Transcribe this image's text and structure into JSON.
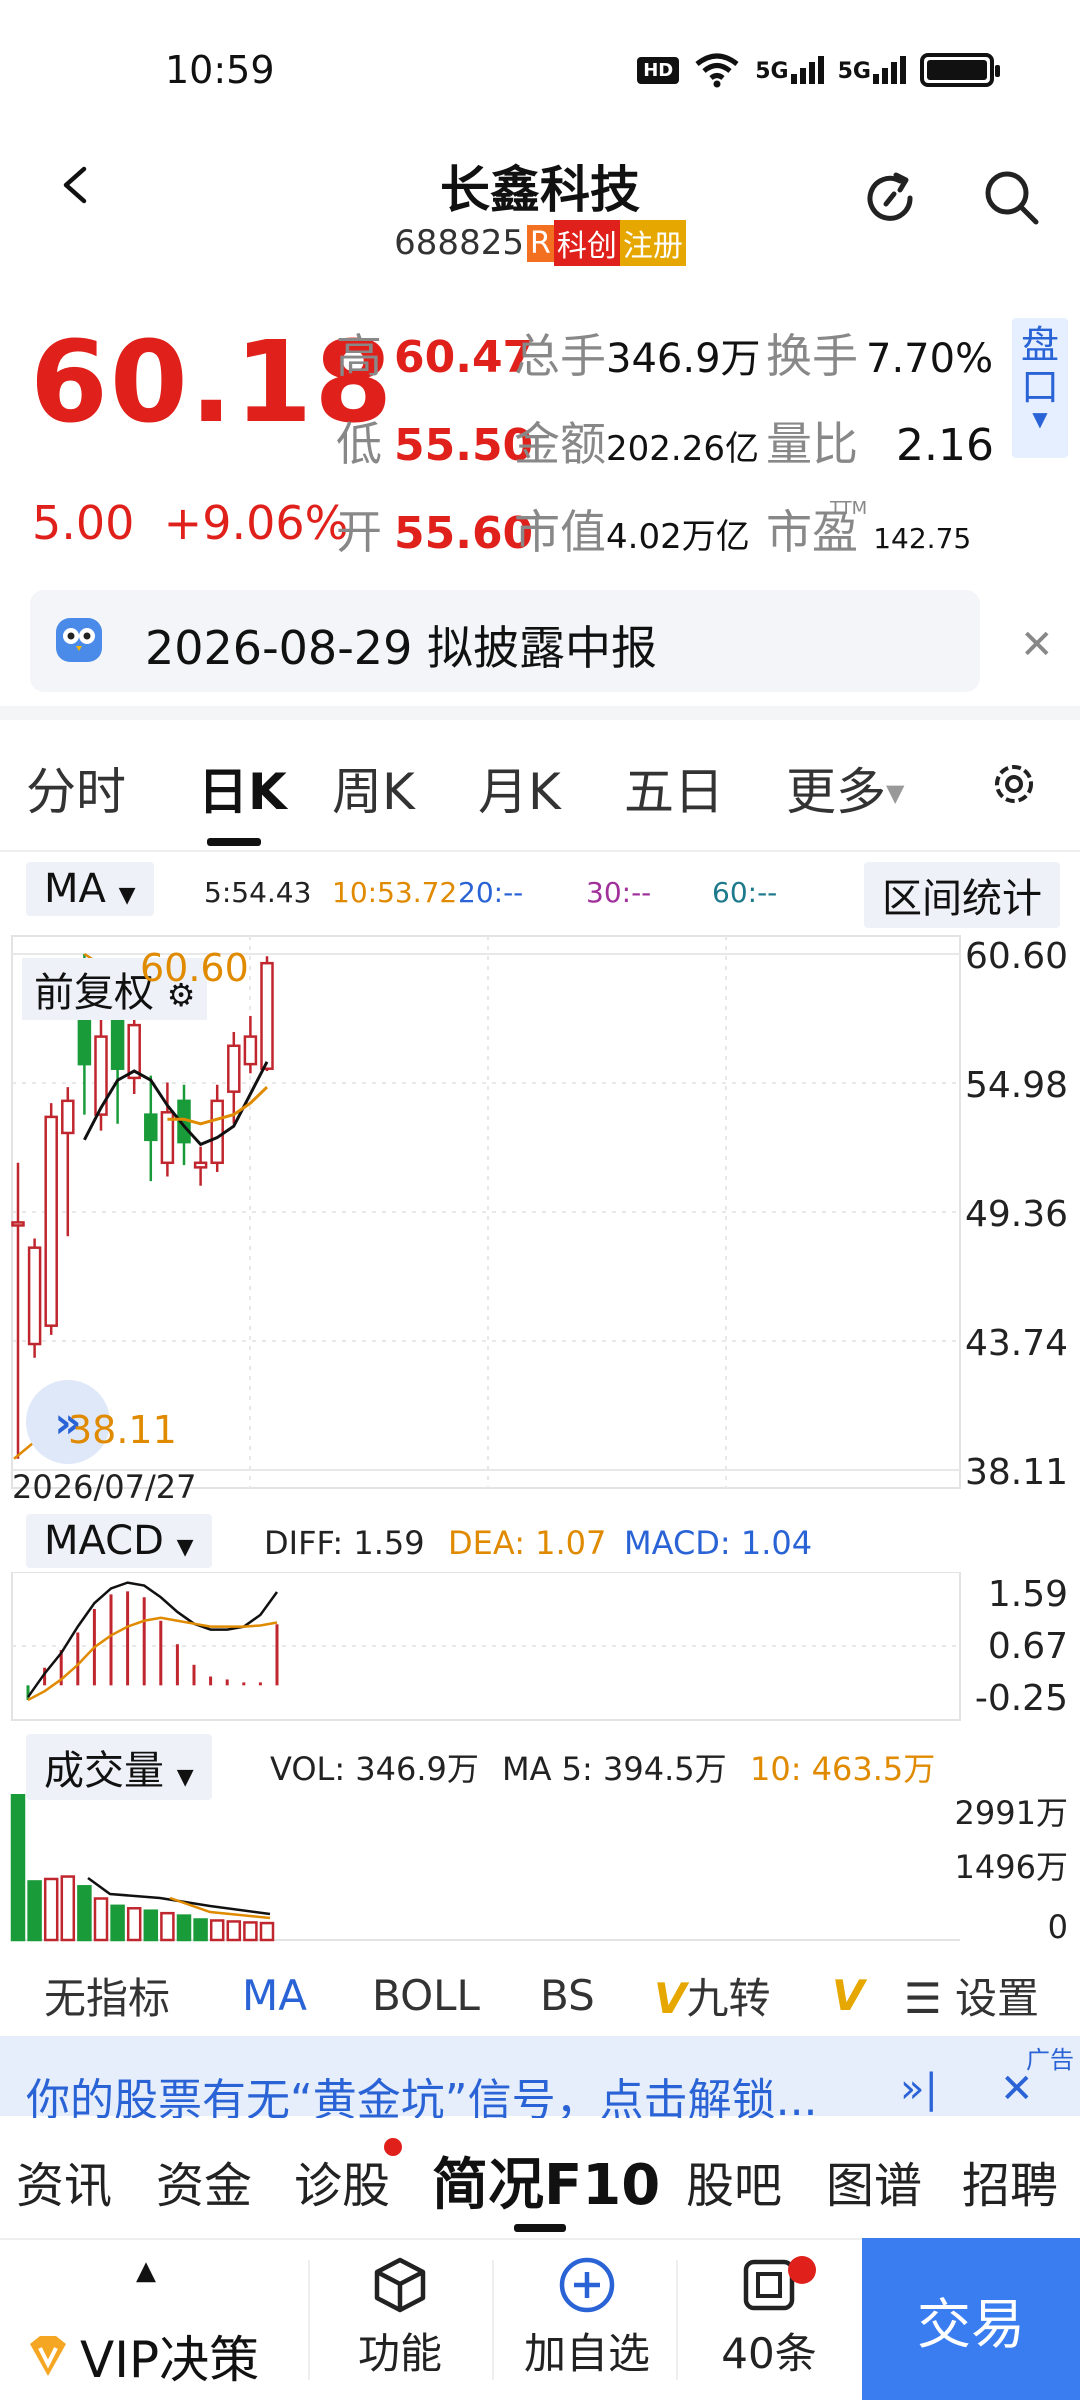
{
  "status": {
    "time": "10:59",
    "hd": "HD",
    "net1": "5G",
    "net2": "5G"
  },
  "header": {
    "title": "长鑫科技",
    "code": "688825",
    "tag_r": "R",
    "tag_kc": "科创",
    "tag_reg": "注册",
    "colors": {
      "r": "#f37021",
      "kc": "#e0201b",
      "reg": "#e6a800"
    }
  },
  "quote": {
    "price": "60.18",
    "change": "5.00",
    "change_pct": "+9.06%",
    "rows": [
      [
        {
          "label": "高",
          "value": "60.47",
          "red": true
        },
        {
          "label": "总手",
          "value": "346.9万",
          "red": false
        },
        {
          "label": "换手",
          "value": "7.70%",
          "red": false
        }
      ],
      [
        {
          "label": "低",
          "value": "55.50",
          "red": true
        },
        {
          "label": "金额",
          "value": "202.26亿",
          "red": false
        },
        {
          "label": "量比",
          "value": "2.16",
          "red": false
        }
      ],
      [
        {
          "label": "开",
          "value": "55.60",
          "red": true
        },
        {
          "label": "市值",
          "value": "4.02万亿",
          "red": false
        },
        {
          "label": "市盈",
          "value": "142.75",
          "red": false
        }
      ]
    ],
    "pe_tag": "TTM",
    "pankou": "盘口"
  },
  "notice": {
    "text": "2026-08-29 拟披露中报"
  },
  "tabs": {
    "items": [
      "分时",
      "日K",
      "周K",
      "月K",
      "五日",
      "更多"
    ],
    "active": 1
  },
  "ma_bar": {
    "button": "MA",
    "m5": "5:54.43",
    "m10": "10:53.72",
    "m20": "20:--",
    "m30": "30:--",
    "m60": "60:--",
    "range_stat": "区间统计",
    "colors": {
      "m5": "#111111",
      "m10": "#e08a00",
      "m20": "#2a63d6",
      "m30": "#a0309a",
      "m60": "#1d7a8c"
    }
  },
  "kchart": {
    "fuquan": "前复权",
    "high_label": "60.60",
    "low_label": "38.11",
    "date_label": "2026/07/27",
    "axis": [
      "60.60",
      "54.98",
      "49.36",
      "43.74",
      "38.11"
    ],
    "ymin": 38.11,
    "ymax": 60.6,
    "candles": [
      {
        "o": 48.9,
        "c": 48.9,
        "h": 51.5,
        "l": 38.6
      },
      {
        "o": 43.6,
        "c": 47.8,
        "h": 48.2,
        "l": 43.0
      },
      {
        "o": 44.4,
        "c": 53.5,
        "h": 54.1,
        "l": 44.0
      },
      {
        "o": 52.8,
        "c": 54.2,
        "h": 54.8,
        "l": 48.3
      },
      {
        "o": 59.5,
        "c": 55.8,
        "h": 60.6,
        "l": 53.6
      },
      {
        "o": 53.6,
        "c": 57.0,
        "h": 57.8,
        "l": 52.9
      },
      {
        "o": 57.8,
        "c": 55.6,
        "h": 57.8,
        "l": 53.2
      },
      {
        "o": 55.2,
        "c": 57.5,
        "h": 58.8,
        "l": 54.5
      },
      {
        "o": 53.6,
        "c": 52.5,
        "h": 55.3,
        "l": 50.7
      },
      {
        "o": 51.5,
        "c": 53.7,
        "h": 55.0,
        "l": 50.9
      },
      {
        "o": 54.2,
        "c": 52.4,
        "h": 54.9,
        "l": 51.4
      },
      {
        "o": 51.3,
        "c": 51.5,
        "h": 52.2,
        "l": 50.5
      },
      {
        "o": 51.5,
        "c": 54.2,
        "h": 54.9,
        "l": 51.1
      },
      {
        "o": 54.6,
        "c": 56.6,
        "h": 57.2,
        "l": 53.2
      },
      {
        "o": 55.8,
        "c": 57.0,
        "h": 57.9,
        "l": 55.4
      },
      {
        "o": 55.6,
        "c": 60.2,
        "h": 60.5,
        "l": 55.5
      }
    ],
    "ma5": [
      null,
      null,
      null,
      null,
      52.5,
      53.9,
      55.1,
      55.5,
      55.1,
      54.0,
      53.1,
      52.3,
      52.6,
      53.1,
      54.5,
      55.9
    ],
    "ma10": [
      null,
      null,
      null,
      null,
      null,
      null,
      null,
      null,
      null,
      53.4,
      53.4,
      53.2,
      53.4,
      53.6,
      54.1,
      54.8
    ]
  },
  "macd": {
    "button": "MACD",
    "diff": "DIFF: 1.59",
    "dea": "DEA: 1.07",
    "macd": "MACD: 1.04",
    "axis": [
      "1.59",
      "0.67",
      "-0.25"
    ],
    "bars": [
      -0.25,
      0.3,
      0.6,
      0.9,
      1.3,
      1.55,
      1.6,
      1.5,
      1.1,
      0.7,
      0.35,
      0.15,
      0.1,
      0.05,
      0.05,
      1.04
    ],
    "diff_line": [
      -0.2,
      0.2,
      0.55,
      1.0,
      1.4,
      1.65,
      1.75,
      1.7,
      1.5,
      1.25,
      1.05,
      0.95,
      0.95,
      1.0,
      1.2,
      1.59
    ],
    "dea_line": [
      -0.25,
      -0.1,
      0.1,
      0.35,
      0.65,
      0.85,
      1.0,
      1.1,
      1.15,
      1.1,
      1.05,
      1.0,
      1.0,
      1.0,
      1.02,
      1.07
    ]
  },
  "volume": {
    "button": "成交量",
    "vol": "VOL: 346.9万",
    "ma5": "MA 5: 394.5万",
    "ma10": "10: 463.5万",
    "axis": [
      "2991万",
      "1496万",
      "0"
    ],
    "max": 2991,
    "bars": [
      {
        "v": 2991,
        "up": false
      },
      {
        "v": 1200,
        "up": false
      },
      {
        "v": 1250,
        "up": true
      },
      {
        "v": 1300,
        "up": true
      },
      {
        "v": 1100,
        "up": false
      },
      {
        "v": 850,
        "up": true
      },
      {
        "v": 700,
        "up": false
      },
      {
        "v": 650,
        "up": true
      },
      {
        "v": 600,
        "up": false
      },
      {
        "v": 550,
        "up": true
      },
      {
        "v": 500,
        "up": false
      },
      {
        "v": 420,
        "up": false
      },
      {
        "v": 400,
        "up": true
      },
      {
        "v": 380,
        "up": true
      },
      {
        "v": 360,
        "up": true
      },
      {
        "v": 346.9,
        "up": true
      }
    ]
  },
  "indicators": {
    "items": [
      "无指标",
      "MA",
      "BOLL",
      "BS",
      "九转",
      "V"
    ],
    "settings": "设置"
  },
  "ad": {
    "text": "你的股票有无“黄金坑”信号，点击解锁...",
    "badge": "广告"
  },
  "f10": {
    "items": [
      "资讯",
      "资金",
      "诊股",
      "简况F10",
      "股吧",
      "图谱",
      "招聘"
    ],
    "active": 3
  },
  "bottom": {
    "vip": "VIP决策",
    "func": "功能",
    "add": "加自选",
    "ask": "40条",
    "trade": "交易"
  }
}
